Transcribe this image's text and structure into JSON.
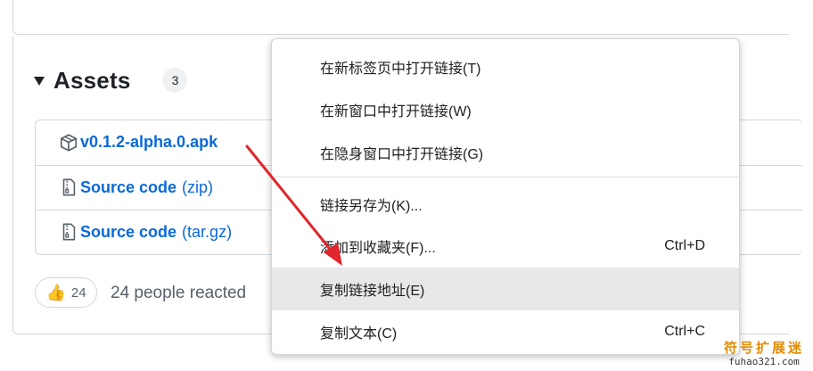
{
  "assets": {
    "title": "Assets",
    "count": "3",
    "items": [
      {
        "name": "v0.1.2-alpha.0.apk",
        "ext": "",
        "icon": "package-icon"
      },
      {
        "name": "Source code",
        "ext": "(zip)",
        "icon": "file-zip-icon"
      },
      {
        "name": "Source code",
        "ext": "(tar.gz)",
        "icon": "file-zip-icon"
      }
    ]
  },
  "reactions": {
    "thumbs_count": "24",
    "summary": "24 people reacted"
  },
  "context_menu": {
    "items": [
      {
        "label": "在新标签页中打开链接(T)",
        "shortcut": ""
      },
      {
        "label": "在新窗口中打开链接(W)",
        "shortcut": ""
      },
      {
        "label": "在隐身窗口中打开链接(G)",
        "shortcut": ""
      },
      {
        "label": "链接另存为(K)...",
        "shortcut": ""
      },
      {
        "label": "添加到收藏夹(F)...",
        "shortcut": "Ctrl+D"
      },
      {
        "label": "复制链接地址(E)",
        "shortcut": "",
        "highlighted": true
      },
      {
        "label": "复制文本(C)",
        "shortcut": "Ctrl+C"
      }
    ]
  },
  "watermark": {
    "line1": "符号扩展迷",
    "line2": "fuhao321.com"
  },
  "colors": {
    "link": "#0969da",
    "arrow": "#e0262c",
    "highlight": "#e8e8e8"
  }
}
